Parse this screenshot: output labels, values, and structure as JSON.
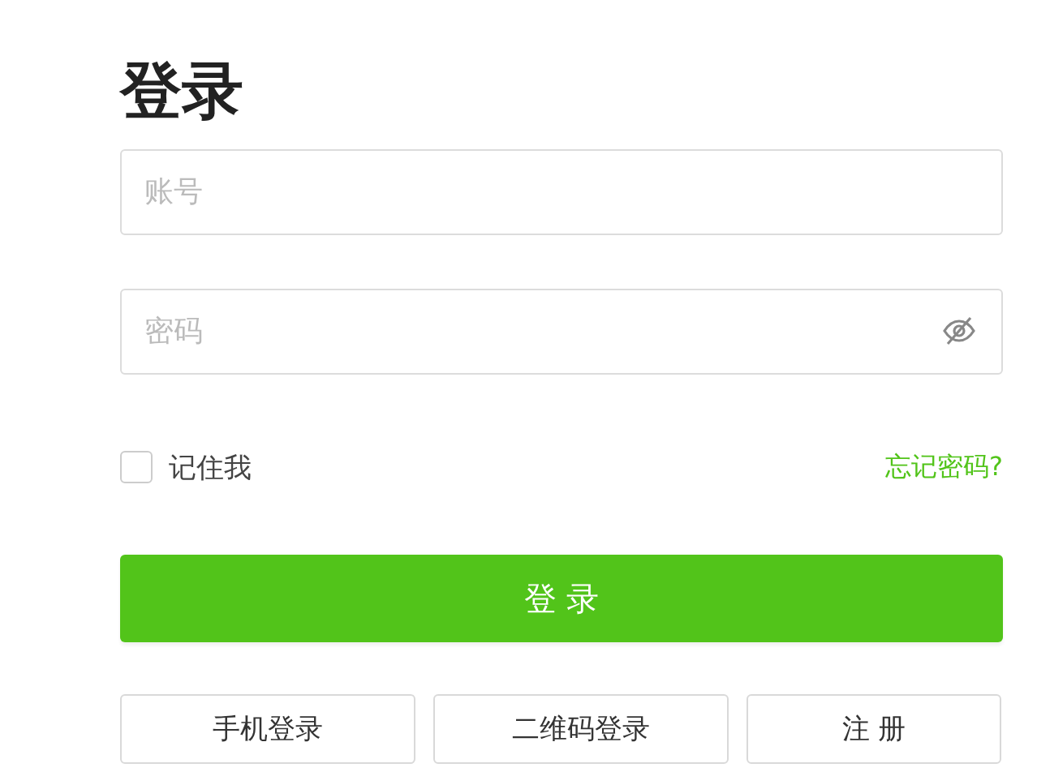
{
  "title": "登录",
  "account": {
    "placeholder": "账号"
  },
  "password": {
    "placeholder": "密码"
  },
  "remember": {
    "label": "记住我",
    "checked": false
  },
  "forgot_link": "忘记密码?",
  "submit": "登 录",
  "alt_buttons": [
    "手机登录",
    "二维码登录",
    "注 册"
  ]
}
